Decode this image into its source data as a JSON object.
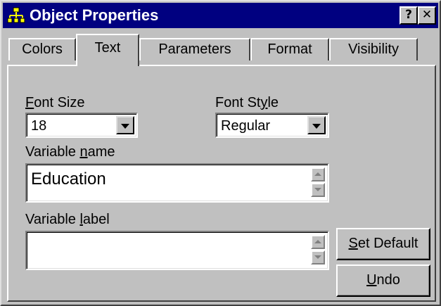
{
  "window": {
    "title": "Object Properties",
    "help_label": "?",
    "close_label": "✕",
    "icon": "network-hierarchy-icon"
  },
  "tabs": [
    {
      "label": "Colors",
      "active": false
    },
    {
      "label": "Text",
      "active": true
    },
    {
      "label": "Parameters",
      "active": false
    },
    {
      "label": "Format",
      "active": false
    },
    {
      "label": "Visibility",
      "active": false
    }
  ],
  "form": {
    "font_size": {
      "label_mnemonic": "F",
      "label_rest": "ont Size",
      "value": "18"
    },
    "font_style": {
      "label_pre": "Font St",
      "label_mnemonic": "y",
      "label_rest": "le",
      "value": "Regular"
    },
    "variable_name": {
      "label_pre": "Variable ",
      "label_mnemonic": "n",
      "label_rest": "ame",
      "value": "Education"
    },
    "variable_label": {
      "label_pre": "Variable ",
      "label_mnemonic": "l",
      "label_rest": "abel",
      "value": ""
    }
  },
  "buttons": {
    "set_default": {
      "mnemonic": "S",
      "rest": "et Default"
    },
    "undo": {
      "mnemonic": "U",
      "rest": "ndo"
    }
  },
  "colors": {
    "title_bar": "#000080",
    "face": "#c0c0c0",
    "field": "#ffffff"
  }
}
